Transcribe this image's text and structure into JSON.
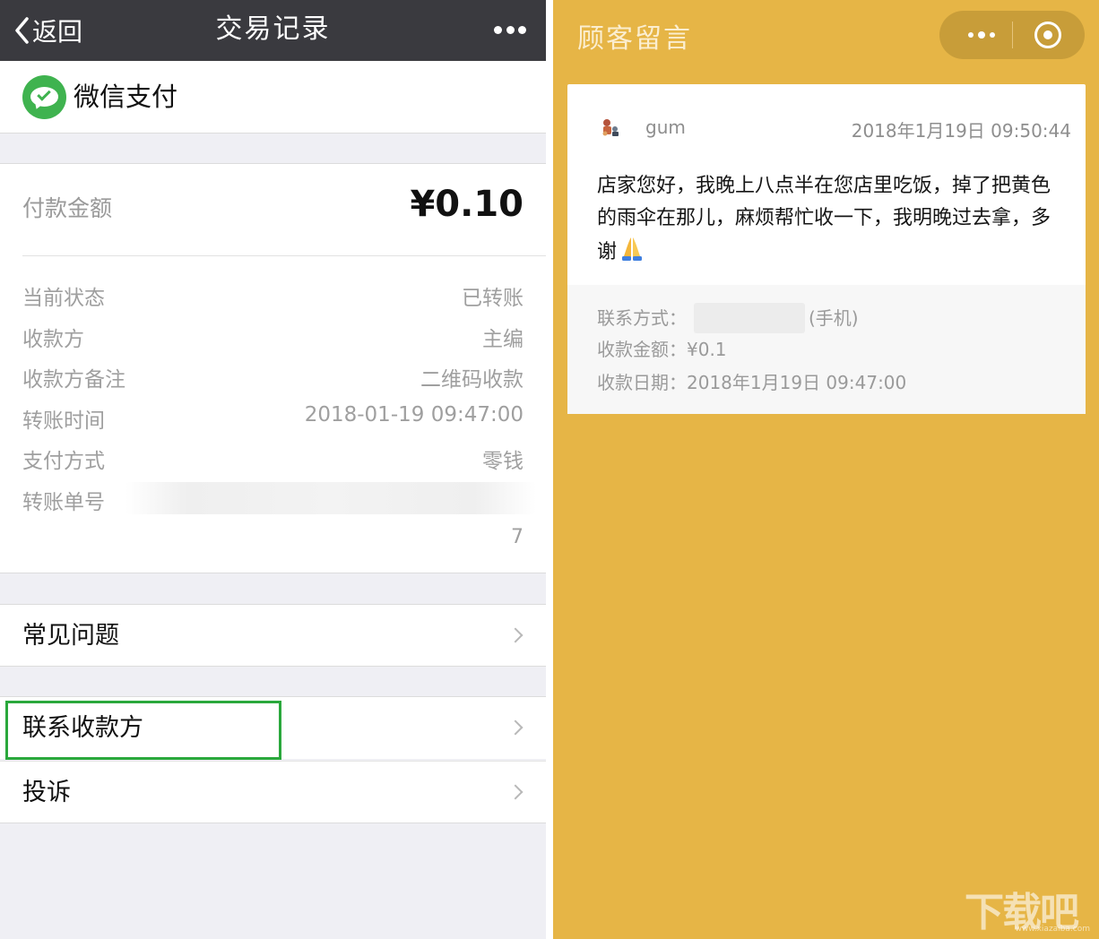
{
  "left": {
    "nav": {
      "back_label": "返回",
      "title": "交易记录"
    },
    "merchant": {
      "name": "微信支付"
    },
    "amount": {
      "label": "付款金额",
      "value": "¥0.10"
    },
    "details": [
      {
        "key": "当前状态",
        "value": "已转账"
      },
      {
        "key": "收款方",
        "value": "主编"
      },
      {
        "key": "收款方备注",
        "value": "二维码收款"
      },
      {
        "key": "转账时间",
        "value": "2018-01-19 09:47:00"
      },
      {
        "key": "支付方式",
        "value": "零钱"
      },
      {
        "key": "转账单号",
        "value": ""
      }
    ],
    "serial_tail": "7",
    "menu": {
      "faq": "常见问题",
      "contact": "联系收款方",
      "complain": "投诉"
    }
  },
  "right": {
    "title": "顾客留言",
    "message": {
      "user": "gum",
      "time": "2018年1月19日 09:50:44",
      "body": "店家您好，我晚上八点半在您店里吃饭，掉了把黄色的雨伞在那儿，麻烦帮忙收一下，我明晚过去拿，多谢",
      "contact_label": "联系方式：",
      "contact_suffix": "(手机)",
      "amount_line": "收款金额：¥0.1",
      "date_line": "收款日期：2018年1月19日 09:47:00"
    }
  },
  "watermark": {
    "text": "下载吧",
    "sub": "www.xiazaiba.com"
  },
  "colors": {
    "nav_bg": "#3a3a3f",
    "wechat_green": "#3fb34f",
    "highlight": "#2aa83c",
    "right_bg": "#e6b546"
  }
}
